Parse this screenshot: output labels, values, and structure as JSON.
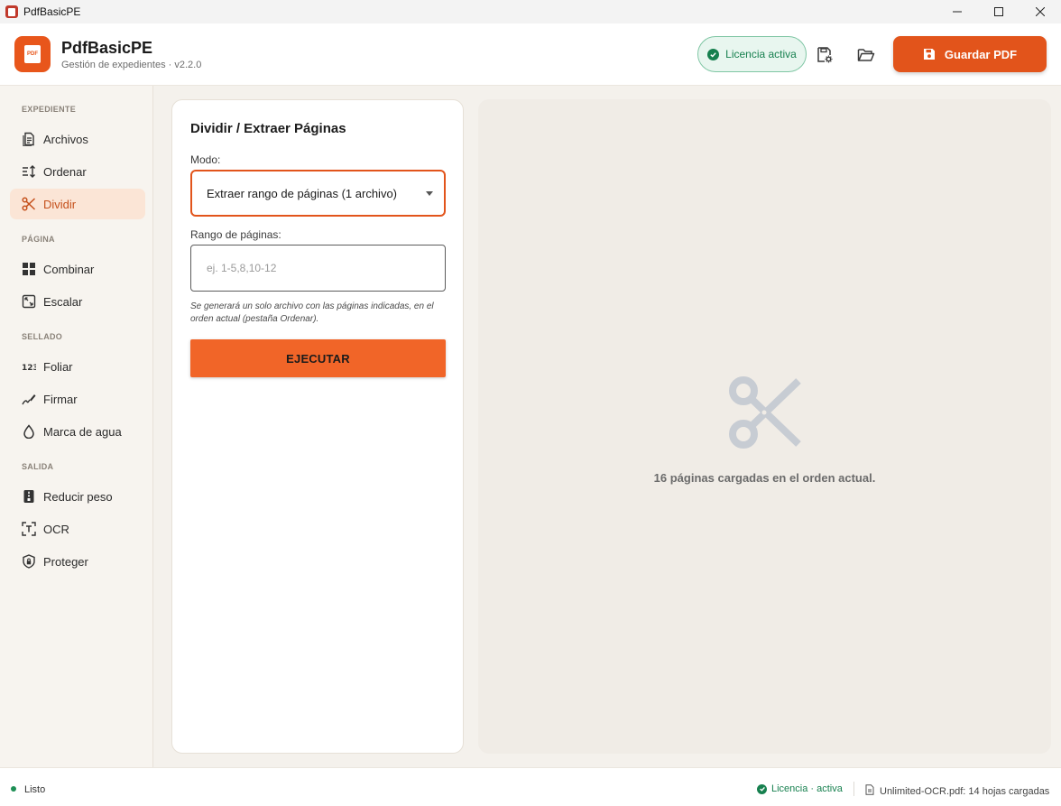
{
  "window": {
    "title": "PdfBasicPE",
    "controls": [
      "minimize-icon",
      "maximize-icon",
      "close-icon"
    ]
  },
  "header": {
    "app_name": "PdfBasicPE",
    "subtitle": "Gestión de expedientes · v2.2.0",
    "logo_text": "PDF",
    "license_badge": "Licencia activa",
    "save_button": "Guardar PDF",
    "icons": [
      "save-settings-icon",
      "folder-open-icon"
    ]
  },
  "sidebar": {
    "sections": [
      {
        "label": "EXPEDIENTE",
        "items": [
          {
            "label": "Archivos",
            "icon": "files-icon"
          },
          {
            "label": "Ordenar",
            "icon": "sort-icon"
          },
          {
            "label": "Dividir",
            "icon": "scissors-icon",
            "active": true
          }
        ]
      },
      {
        "label": "PÁGINA",
        "items": [
          {
            "label": "Combinar",
            "icon": "grid-icon"
          },
          {
            "label": "Escalar",
            "icon": "scale-icon"
          }
        ]
      },
      {
        "label": "SELLADO",
        "items": [
          {
            "label": "Foliar",
            "icon": "numbers-icon"
          },
          {
            "label": "Firmar",
            "icon": "signature-icon"
          },
          {
            "label": "Marca de agua",
            "icon": "drop-icon"
          }
        ]
      },
      {
        "label": "SALIDA",
        "items": [
          {
            "label": "Reducir peso",
            "icon": "compress-icon"
          },
          {
            "label": "OCR",
            "icon": "ocr-icon"
          },
          {
            "label": "Proteger",
            "icon": "shield-icon"
          }
        ]
      }
    ]
  },
  "panel": {
    "title": "Dividir / Extraer Páginas",
    "mode_label": "Modo:",
    "mode_value": "Extraer rango de páginas (1 archivo)",
    "range_label": "Rango de páginas:",
    "range_placeholder": "ej. 1-5,8,10-12",
    "range_value": "",
    "hint": "Se generará un solo archivo con las páginas indicadas, en el orden actual (pestaña Ordenar).",
    "execute_button": "EJECUTAR"
  },
  "preview": {
    "icon": "scissors-icon",
    "message": "16 páginas cargadas en el orden actual."
  },
  "statusbar": {
    "status": "Listo",
    "license": "Licencia · activa",
    "file_info": "Unlimited-OCR.pdf: 14 hojas cargadas"
  },
  "colors": {
    "accent": "#e2541b",
    "accent_light": "#fbe5d6",
    "success": "#17804f",
    "background": "#f4f1ec"
  }
}
